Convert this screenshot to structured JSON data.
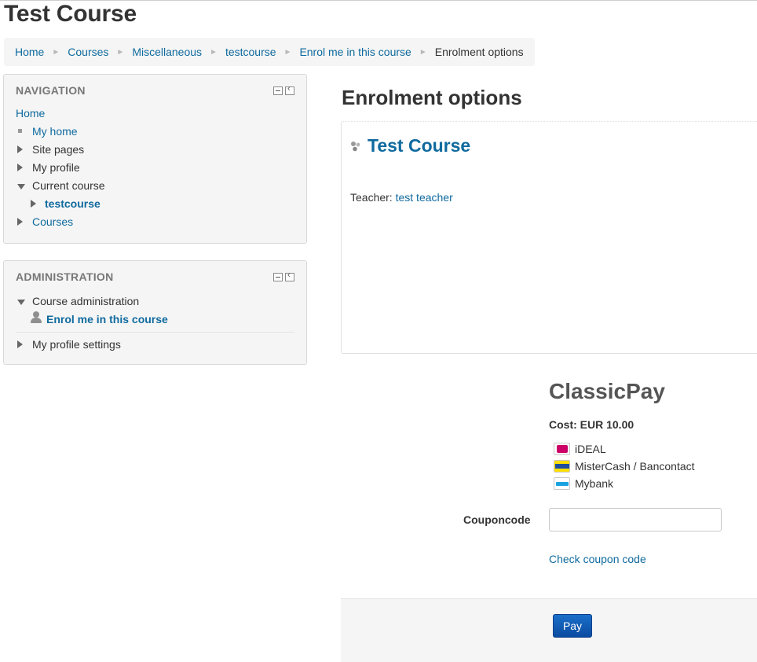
{
  "page": {
    "title": "Test Course"
  },
  "breadcrumb": {
    "items": [
      "Home",
      "Courses",
      "Miscellaneous",
      "testcourse",
      "Enrol me in this course"
    ],
    "current": "Enrolment options",
    "separator": "►"
  },
  "navigation": {
    "title": "NAVIGATION",
    "home": "Home",
    "items": [
      "My home",
      "Site pages",
      "My profile",
      "Current course",
      "testcourse",
      "Courses"
    ]
  },
  "administration": {
    "title": "ADMINISTRATION",
    "course_admin": "Course administration",
    "enrol": "Enrol me in this course",
    "profile_settings": "My profile settings"
  },
  "main": {
    "heading": "Enrolment options",
    "course_name": "Test Course",
    "teacher_label": "Teacher:",
    "teacher_name": "test teacher"
  },
  "payment": {
    "title": "ClassicPay",
    "cost": "Cost: EUR 10.00",
    "methods": [
      "iDEAL",
      "MisterCash / Bancontact",
      "Mybank"
    ],
    "coupon_label": "Couponcode",
    "coupon_value": "",
    "check_coupon": "Check coupon code",
    "pay_button": "Pay"
  },
  "colors": {
    "link": "#0f6a9e",
    "pay_button": "#0a4ba1"
  }
}
